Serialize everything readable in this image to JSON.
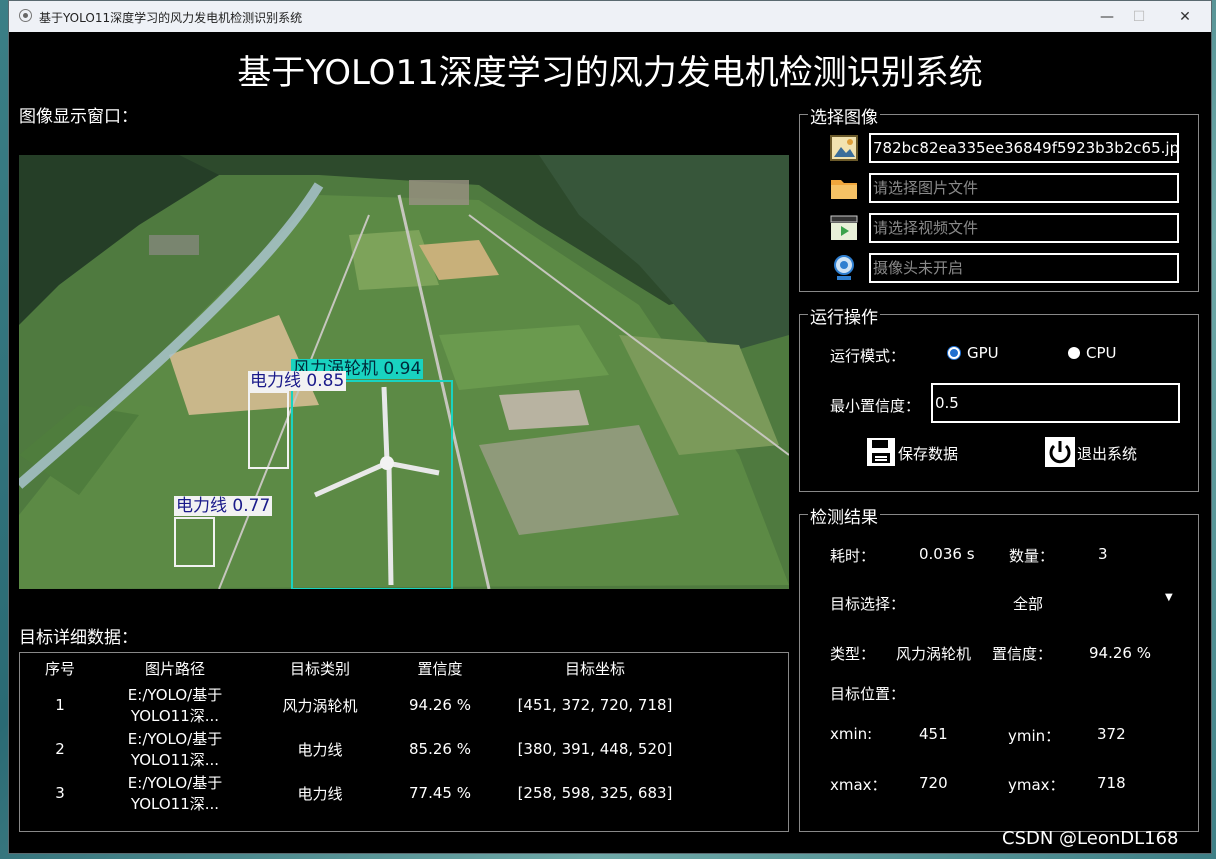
{
  "window": {
    "title": "基于YOLO11深度学习的风力发电机检测识别系统"
  },
  "header": {
    "title": "基于YOLO11深度学习的风力发电机检测识别系统"
  },
  "image_panel": {
    "label": "图像显示窗口：",
    "detections": [
      {
        "label": "风力涡轮机 0.94",
        "color": "#19d3c0"
      },
      {
        "label": "电力线 0.85",
        "color": "#f2f2f2"
      },
      {
        "label": "电力线 0.77",
        "color": "#f2f2f2"
      }
    ]
  },
  "details": {
    "label": "目标详细数据：",
    "columns": [
      "序号",
      "图片路径",
      "目标类别",
      "置信度",
      "目标坐标"
    ],
    "rows": [
      [
        "1",
        "E:/YOLO/基于YOLO11深...",
        "风力涡轮机",
        "94.26 %",
        "[451, 372, 720, 718]"
      ],
      [
        "2",
        "E:/YOLO/基于YOLO11深...",
        "电力线",
        "85.26 %",
        "[380, 391, 448, 520]"
      ],
      [
        "3",
        "E:/YOLO/基于YOLO11深...",
        "电力线",
        "77.45 %",
        "[258, 598, 325, 683]"
      ]
    ]
  },
  "select_image": {
    "title": "选择图像",
    "image_file": "782bc82ea335ee36849f5923b3b2c65.jpg",
    "image_dir_placeholder": "请选择图片文件",
    "video_placeholder": "请选择视频文件",
    "camera_placeholder": "摄像头未开启"
  },
  "run": {
    "title": "运行操作",
    "mode_label": "运行模式：",
    "gpu_label": "GPU",
    "cpu_label": "CPU",
    "selected_mode": "GPU",
    "conf_label": "最小置信度：",
    "conf_value": "0.5",
    "save_label": "保存数据",
    "exit_label": "退出系统"
  },
  "results": {
    "title": "检测结果",
    "time_label": "耗时：",
    "time_value": "0.036 s",
    "count_label": "数量：",
    "count_value": "3",
    "target_select_label": "目标选择：",
    "target_select_value": "全部",
    "type_label": "类型：",
    "type_value": "风力涡轮机",
    "conf_label": "置信度：",
    "conf_value": "94.26 %",
    "position_label": "目标位置：",
    "xmin_label": "xmin:",
    "xmin_value": "451",
    "ymin_label": "ymin：",
    "ymin_value": "372",
    "xmax_label": "xmax：",
    "xmax_value": "720",
    "ymax_label": "ymax：",
    "ymax_value": "718"
  },
  "watermark": "CSDN @LeonDL168"
}
